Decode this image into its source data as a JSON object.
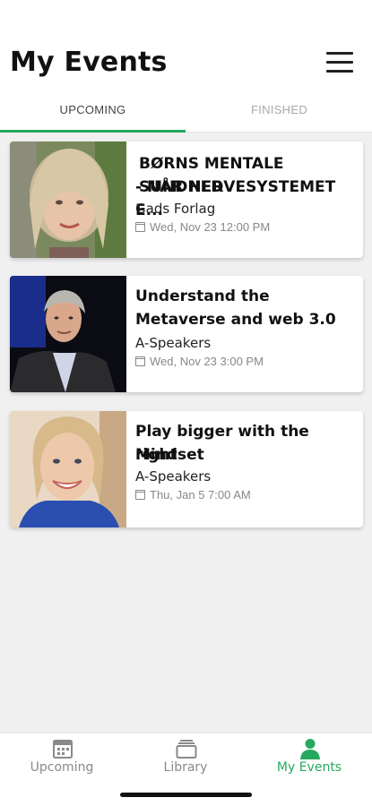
{
  "header": {
    "title": "My Events"
  },
  "tabs": [
    {
      "label": "UPCOMING",
      "active": true
    },
    {
      "label": "FINISHED",
      "active": false
    }
  ],
  "events": [
    {
      "title_line1": "BØRNS MENTALE SUNDHED",
      "title_line2": "- NÅR NERVESYSTEMET E...",
      "organizer": "Gads Forlag",
      "date": "Wed, Nov 23 12:00 PM"
    },
    {
      "title_line1": "Understand the",
      "title_line2": "Metaverse and web 3.0",
      "organizer": "A-Speakers",
      "date": "Wed, Nov 23 3:00 PM"
    },
    {
      "title_line1": "Play bigger with the right",
      "title_line2": "Mindset",
      "organizer": "A-Speakers",
      "date": "Thu, Jan 5 7:00 AM"
    }
  ],
  "bottom_nav": [
    {
      "label": "Upcoming",
      "icon": "calendar-icon",
      "active": false
    },
    {
      "label": "Library",
      "icon": "library-icon",
      "active": false
    },
    {
      "label": "My Events",
      "icon": "person-icon",
      "active": true
    }
  ],
  "colors": {
    "accent": "#26a85e",
    "inactive": "#8a8a8a"
  }
}
